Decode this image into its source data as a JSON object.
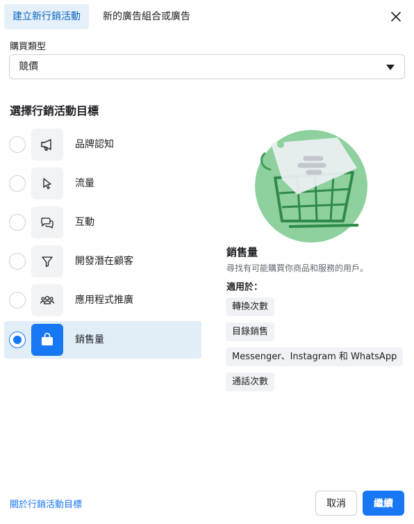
{
  "tabs": {
    "create_campaign": "建立新行銷活動",
    "new_adset": "新的廣告組合或廣告"
  },
  "buy_type": {
    "label": "購買類型",
    "value": "競價"
  },
  "section_title": "選擇行銷活動目標",
  "objectives": [
    {
      "label": "品牌認知",
      "icon": "megaphone-icon",
      "selected": false
    },
    {
      "label": "流量",
      "icon": "cursor-icon",
      "selected": false
    },
    {
      "label": "互動",
      "icon": "chat-bubbles-icon",
      "selected": false
    },
    {
      "label": "開發潛在顧客",
      "icon": "funnel-icon",
      "selected": false
    },
    {
      "label": "應用程式推廣",
      "icon": "people-icon",
      "selected": false
    },
    {
      "label": "銷售量",
      "icon": "shopping-bag-icon",
      "selected": true
    }
  ],
  "detail": {
    "title": "銷售量",
    "description": "尋找有可能購買你商品和服務的用戶。",
    "apply_label": "適用於：",
    "chips": [
      "轉換次數",
      "目錄銷售",
      "Messenger、Instagram 和 WhatsApp",
      "通話次數"
    ]
  },
  "footer": {
    "learn_link": "關於行銷活動目標",
    "cancel": "取消",
    "continue": "繼續"
  },
  "colors": {
    "primary": "#1877f2",
    "selected_row": "#e1edf7",
    "illustration_green": "#8fd19e"
  }
}
